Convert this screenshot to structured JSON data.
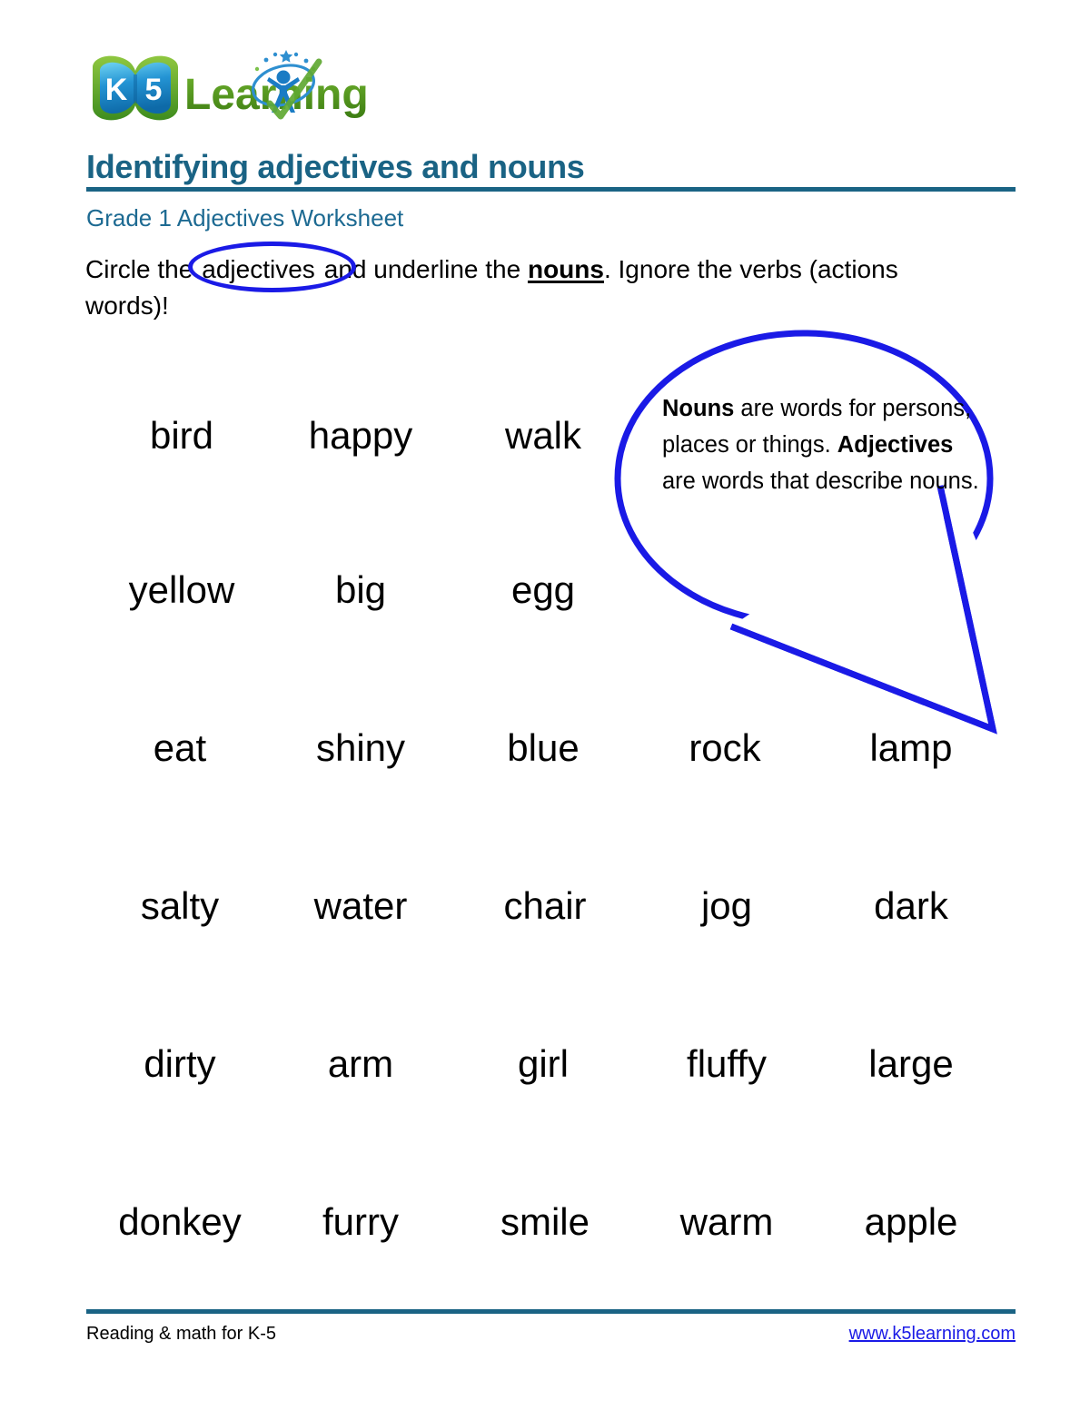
{
  "logo": {
    "book_text": "K5",
    "brand_text": "Learning",
    "icon_names": [
      "k5-book-icon",
      "learner-person-icon",
      "checkmark-icon",
      "stars-icon"
    ],
    "colors": {
      "book_blue": "#1F9BD8",
      "book_green": "#7DBE3C",
      "brand_green": "#4C9B1E",
      "person_blue": "#1B7CC4",
      "check_green": "#5FA832"
    }
  },
  "header": {
    "title": "Identifying adjectives and nouns",
    "subtitle": "Grade 1 Adjectives Worksheet",
    "title_color": "#1A6384",
    "subtitle_color": "#1D6A92",
    "rule_color": "#1A6384"
  },
  "instructions": {
    "part1": "Circle the",
    "circled_word": "adjectives",
    "part2": "and underline the",
    "underlined_word": "nouns",
    "part3": ".  Ignore the verbs (actions words)!",
    "circle_color": "#1A1AE6"
  },
  "hint_bubble": {
    "line1_bold": "Nouns",
    "line1_rest": " are words for persons, places or things.  ",
    "line2_bold": "Adjectives",
    "line2_rest": " are words that describe nouns.",
    "full_text": "Nouns are words for persons, places or things.  Adjectives are words that describe nouns.",
    "outline_color": "#1A1AE6"
  },
  "word_grid": {
    "rows": [
      {
        "words": [
          "bird",
          "happy",
          "walk"
        ],
        "columns": 3
      },
      {
        "words": [
          "yellow",
          "big",
          "egg"
        ],
        "columns": 3
      },
      {
        "words": [
          "eat",
          "shiny",
          "blue",
          "rock",
          "lamp"
        ],
        "columns": 5
      },
      {
        "words": [
          "salty",
          "water",
          "chair",
          "jog",
          "dark"
        ],
        "columns": 5
      },
      {
        "words": [
          "dirty",
          "arm",
          "girl",
          "fluffy",
          "large"
        ],
        "columns": 5
      },
      {
        "words": [
          "donkey",
          "furry",
          "smile",
          "warm",
          "apple"
        ],
        "columns": 5
      }
    ]
  },
  "footer": {
    "left_text": "Reading & math for K-5",
    "link_text": "www.k5learning.com",
    "link_color": "#1A1AE6",
    "rule_color": "#1A6384"
  }
}
